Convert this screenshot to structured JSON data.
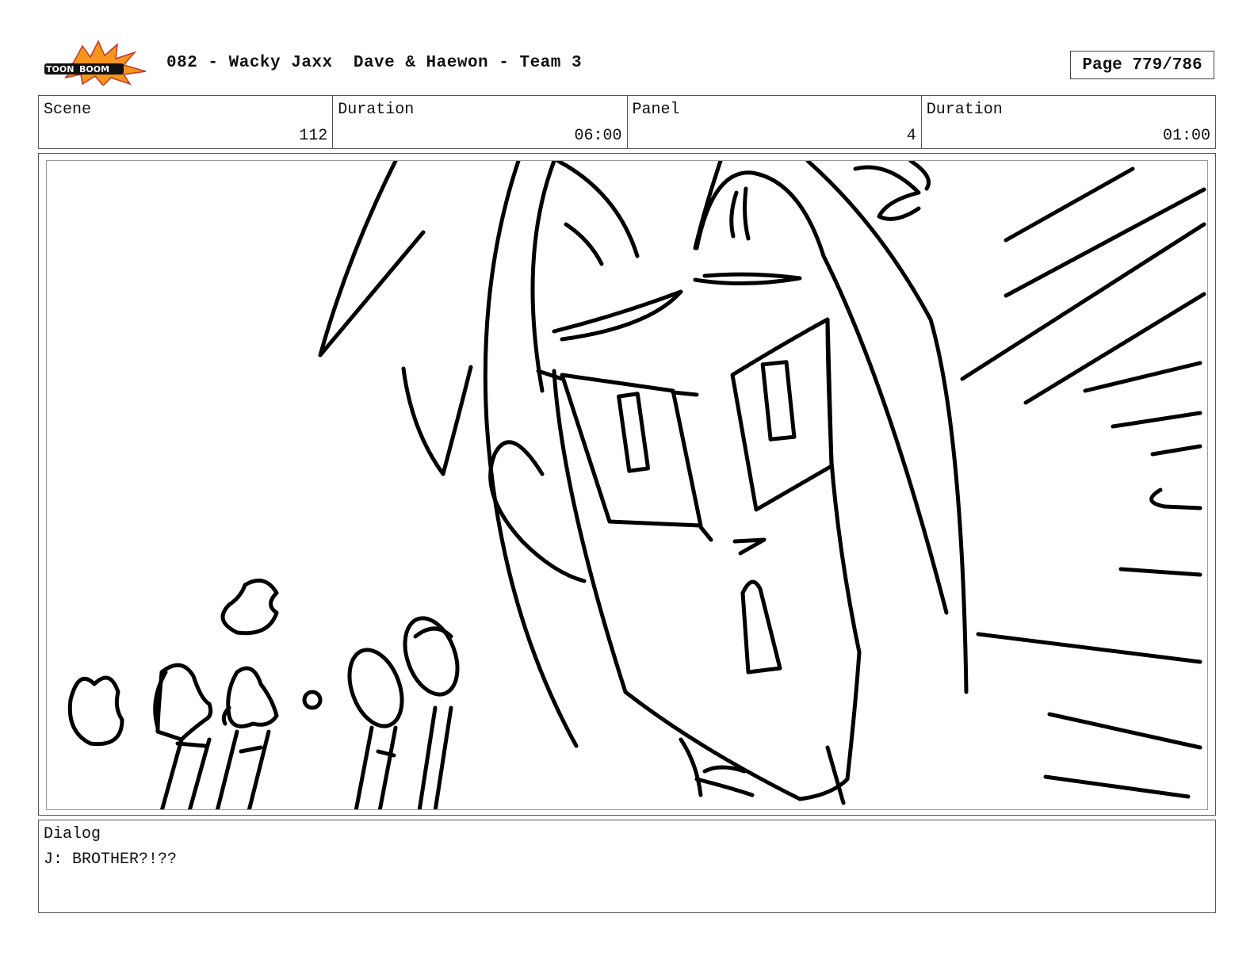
{
  "header": {
    "logo_text": "TOONBOOM",
    "title": "082 - Wacky Jaxx  Dave & Haewon - Team 3",
    "page": "Page 779/786"
  },
  "info": {
    "scene_label": "Scene",
    "scene_value": "112",
    "duration_label": "Duration",
    "duration_value": "06:00",
    "panel_label": "Panel",
    "panel_value": "4",
    "panel_duration_label": "Duration",
    "panel_duration_value": "01:00"
  },
  "dialog": {
    "label": "Dialog",
    "text": "J: BROTHER?!??"
  }
}
